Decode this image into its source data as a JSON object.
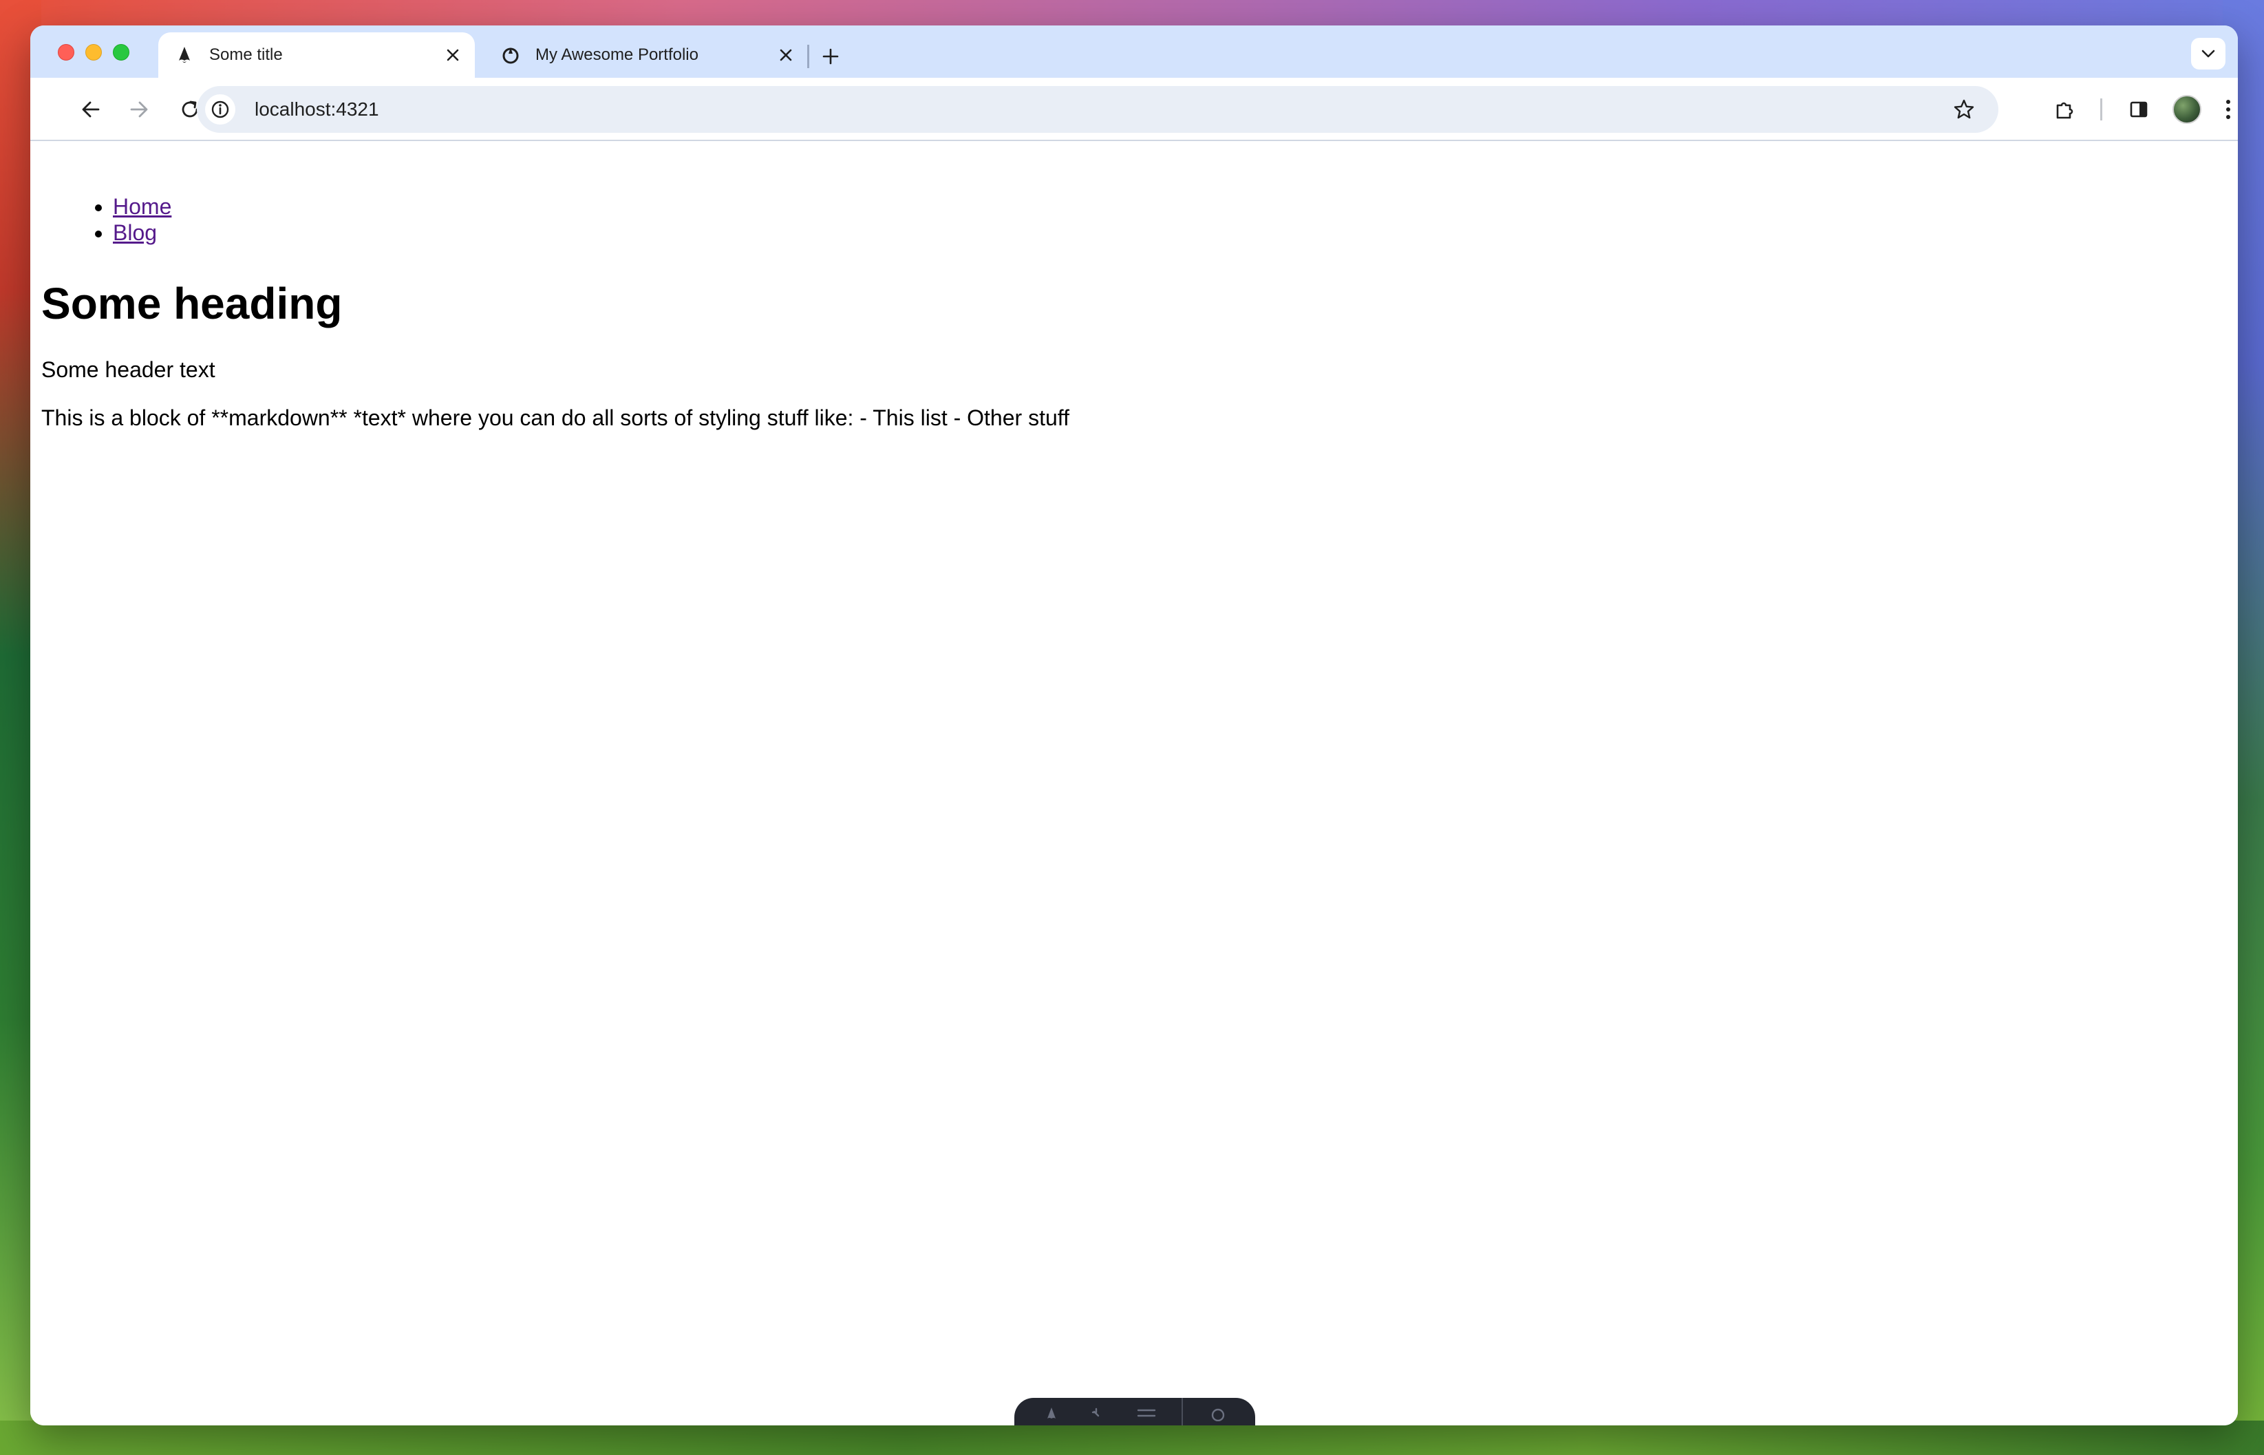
{
  "browser": {
    "tabs": [
      {
        "title": "Some title",
        "active": true,
        "favicon": "astro-icon"
      },
      {
        "title": "My Awesome Portfolio",
        "active": false,
        "favicon": "astro-icon"
      }
    ],
    "address": {
      "url": "localhost:4321"
    }
  },
  "page": {
    "nav": [
      {
        "label": "Home"
      },
      {
        "label": "Blog"
      }
    ],
    "title": "Some heading",
    "header_text": "Some header text",
    "body_text": "This is a block of **markdown** *text* where you can do all sorts of styling stuff like: - This list - Other stuff"
  },
  "colors": {
    "tabstrip": "#d3e3fd",
    "omnibox": "#e9eef6",
    "link_visited": "#551a8b",
    "dev_toolbar": "#23262f"
  }
}
